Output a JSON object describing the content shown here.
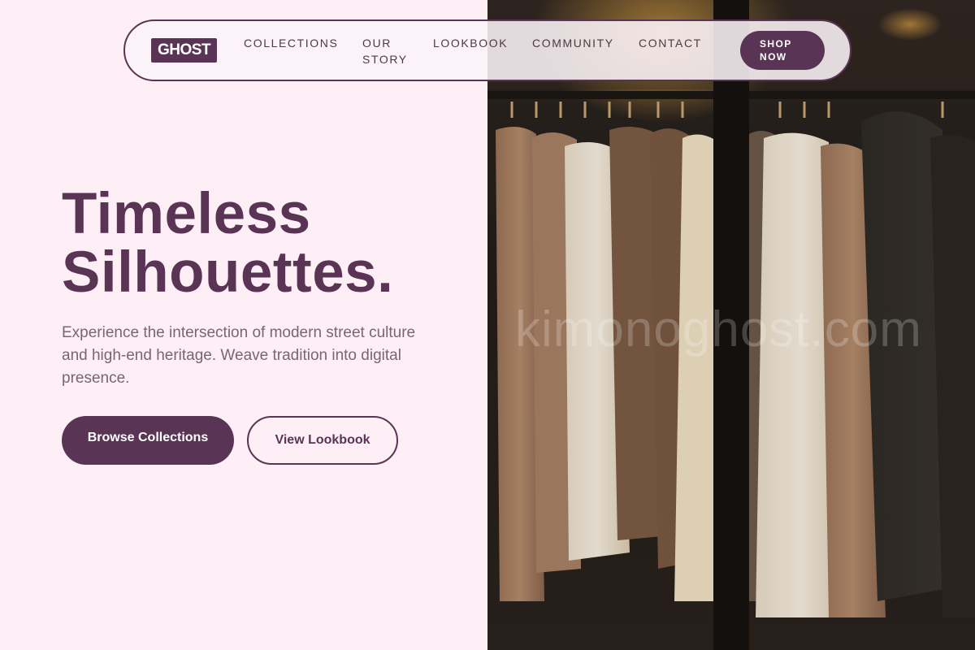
{
  "nav": {
    "logo": "GHOST",
    "links": [
      "COLLECTIONS",
      "OUR STORY",
      "LOOKBOOK",
      "COMMUNITY",
      "CONTACT"
    ],
    "cta": "SHOP NOW"
  },
  "hero": {
    "title_line1": "Timeless",
    "title_line2": "Silhouettes.",
    "subtitle": "Experience the intersection of modern street culture and high-end heritage. Weave tradition into digital presence.",
    "primary_button": "Browse Collections",
    "secondary_button": "View Lookbook"
  },
  "image": {
    "watermark": "kimonoghost.com"
  },
  "colors": {
    "brand": "#5a3454",
    "background": "#fdeff5",
    "text_muted": "#7a6572"
  }
}
